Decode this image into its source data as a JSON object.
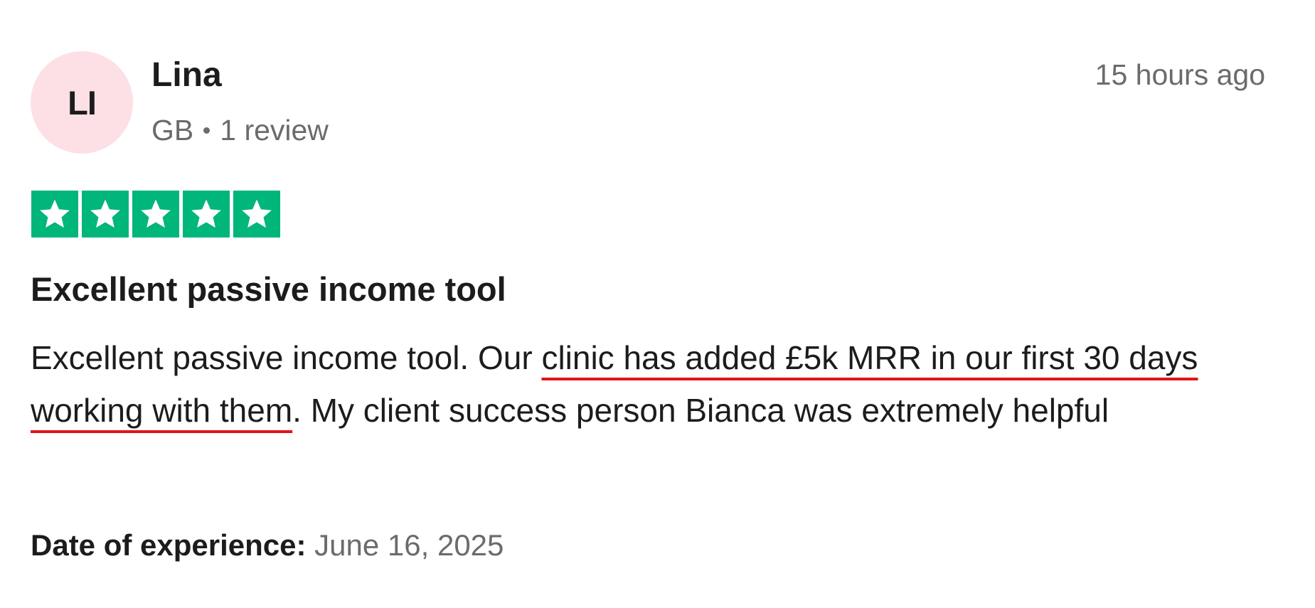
{
  "reviewer": {
    "initials": "LI",
    "name": "Lina",
    "country": "GB",
    "review_count": "1 review",
    "avatar_color": "#fde0e6"
  },
  "review": {
    "timestamp": "15 hours ago",
    "rating": 5,
    "rating_max": 5,
    "star_color": "#00b67a",
    "title": "Excellent passive income tool",
    "body_before": "Excellent passive income tool. Our ",
    "body_highlight": "clinic has added £5k MRR in our first 30 days working with them",
    "body_after": ". My client success person Bianca was extremely helpful",
    "highlight_underline_color": "#e0151b",
    "date_of_experience_label": "Date of experience:",
    "date_of_experience": "June 16, 2025"
  }
}
